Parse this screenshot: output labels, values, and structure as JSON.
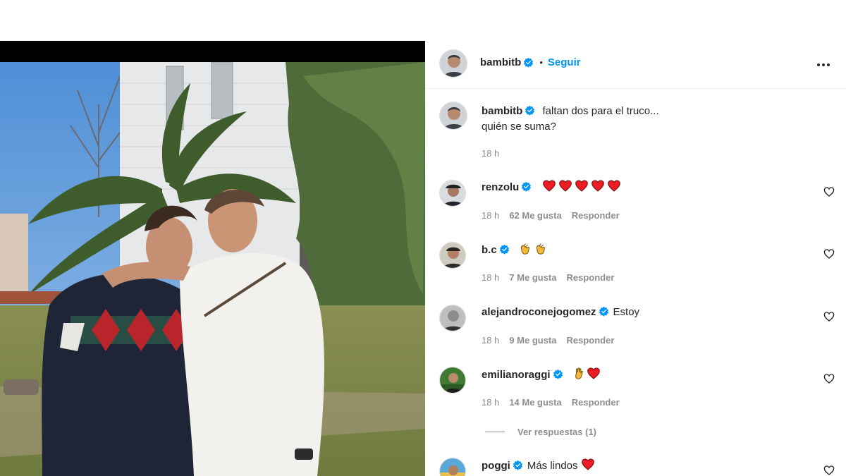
{
  "post": {
    "author": "bambitb",
    "follow_label": "Seguir",
    "separator": "•",
    "caption_line1": "faltan dos para el truco...",
    "caption_line2": "quién se suma?",
    "caption_time": "18 h"
  },
  "comments": [
    {
      "user": "renzolu",
      "text": "",
      "emoji": [
        "heart",
        "heart",
        "heart",
        "heart",
        "heart"
      ],
      "time": "18 h",
      "likes": "62 Me gusta",
      "reply": "Responder"
    },
    {
      "user": "b.c",
      "text": "",
      "emoji": [
        "clap",
        "clap"
      ],
      "time": "18 h",
      "likes": "7 Me gusta",
      "reply": "Responder"
    },
    {
      "user": "alejandroconejogomez",
      "text": "Estoy",
      "emoji": [],
      "time": "18 h",
      "likes": "9 Me gusta",
      "reply": "Responder"
    },
    {
      "user": "emilianoraggi",
      "text": "",
      "emoji": [
        "wave-hand",
        "heart"
      ],
      "time": "18 h",
      "likes": "14 Me gusta",
      "reply": "Responder"
    },
    {
      "user": "poggi",
      "text": "Más lindos",
      "emoji": [
        "heart"
      ],
      "time": "",
      "likes": "",
      "reply": ""
    }
  ],
  "view_replies": "Ver respuestas (1)",
  "colors": {
    "accent": "#0095f6",
    "verified": "#0095f6",
    "heart": "#ed1c24",
    "muted": "#8e8e8e"
  }
}
